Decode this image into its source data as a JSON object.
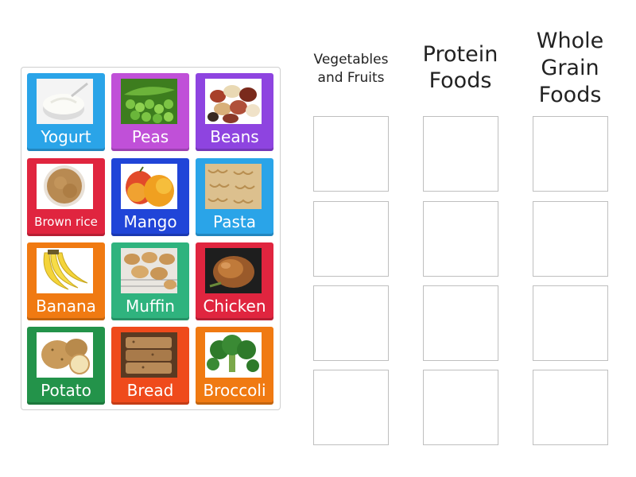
{
  "columns": [
    {
      "title": "Vegetables and Fruits"
    },
    {
      "title": "Protein Foods"
    },
    {
      "title": "Whole Grain Foods"
    }
  ],
  "cards": [
    {
      "label": "Yogurt",
      "color": "#2aa4e8",
      "icon": "yogurt-icon"
    },
    {
      "label": "Peas",
      "color": "#c050d8",
      "icon": "peas-icon"
    },
    {
      "label": "Beans",
      "color": "#8e44e0",
      "icon": "beans-icon"
    },
    {
      "label": "Brown rice",
      "color": "#e0253f",
      "icon": "brown-rice-icon"
    },
    {
      "label": "Mango",
      "color": "#2045d8",
      "icon": "mango-icon"
    },
    {
      "label": "Pasta",
      "color": "#2aa4e8",
      "icon": "pasta-icon"
    },
    {
      "label": "Banana",
      "color": "#f07a12",
      "icon": "banana-icon"
    },
    {
      "label": "Muffin",
      "color": "#2fb37e",
      "icon": "muffin-icon"
    },
    {
      "label": "Chicken",
      "color": "#e0253f",
      "icon": "chicken-icon"
    },
    {
      "label": "Potato",
      "color": "#23934a",
      "icon": "potato-icon"
    },
    {
      "label": "Bread",
      "color": "#ef4a1c",
      "icon": "bread-icon"
    },
    {
      "label": "Broccoli",
      "color": "#f07a12",
      "icon": "broccoli-icon"
    }
  ],
  "drop_rows": 4
}
